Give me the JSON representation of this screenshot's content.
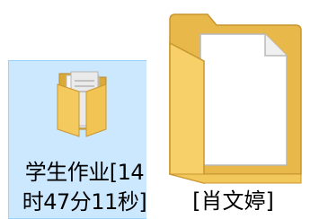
{
  "items": [
    {
      "name_line1": "学生作业[14",
      "name_line2": "时47分11秒]",
      "icon": "folder-with-papers-icon",
      "selected": true
    },
    {
      "name": "[肖文婷]",
      "icon": "folder-with-document-icon",
      "selected": false
    }
  ],
  "colors": {
    "selection_fill": "#cce8ff",
    "selection_border": "#99d1ff",
    "folder_yellow": "#f4c95e"
  }
}
